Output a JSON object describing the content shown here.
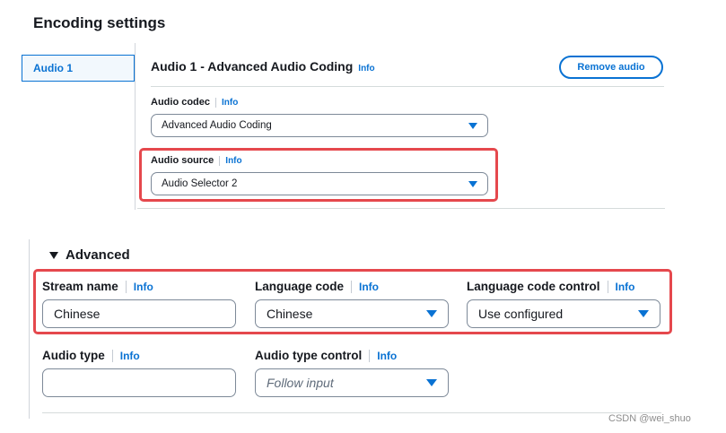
{
  "header": {
    "title": "Encoding settings"
  },
  "tabs": [
    {
      "label": "Audio 1"
    }
  ],
  "panel": {
    "title": "Audio 1 - Advanced Audio Coding",
    "info": "Info",
    "remove_button": "Remove audio"
  },
  "audio_codec": {
    "label": "Audio codec",
    "info": "Info",
    "value": "Advanced Audio Coding"
  },
  "audio_source": {
    "label": "Audio source",
    "info": "Info",
    "value": "Audio Selector 2"
  },
  "advanced": {
    "title": "Advanced",
    "stream_name": {
      "label": "Stream name",
      "info": "Info",
      "value": "Chinese"
    },
    "language_code": {
      "label": "Language code",
      "info": "Info",
      "value": "Chinese"
    },
    "language_code_control": {
      "label": "Language code control",
      "info": "Info",
      "value": "Use configured"
    },
    "audio_type": {
      "label": "Audio type",
      "info": "Info",
      "value": ""
    },
    "audio_type_control": {
      "label": "Audio type control",
      "info": "Info",
      "value": "Follow input"
    }
  },
  "watermark": "CSDN @wei_shuo",
  "colors": {
    "accent": "#0972d3",
    "highlight": "#e5484d",
    "text": "#16191f"
  }
}
